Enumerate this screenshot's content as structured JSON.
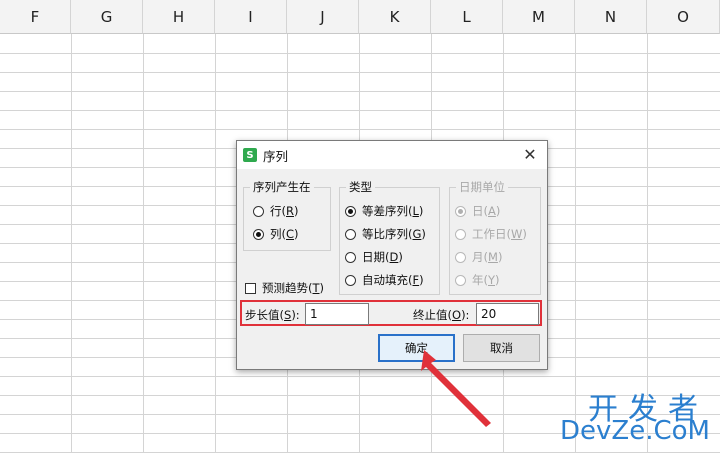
{
  "spreadsheet": {
    "columns": [
      "F",
      "G",
      "H",
      "I",
      "J",
      "K",
      "L",
      "M",
      "N",
      "O"
    ]
  },
  "dialog": {
    "title": "序列",
    "app_icon_glyph": "S",
    "close_glyph": "✕",
    "group_series_in": {
      "legend": "序列产生在",
      "options": [
        {
          "text": "行(",
          "key": "R",
          "suffix": ")",
          "selected": false
        },
        {
          "text": "列(",
          "key": "C",
          "suffix": ")",
          "selected": true
        }
      ]
    },
    "group_type": {
      "legend": "类型",
      "options": [
        {
          "text": "等差序列(",
          "key": "L",
          "suffix": ")",
          "selected": true
        },
        {
          "text": "等比序列(",
          "key": "G",
          "suffix": ")",
          "selected": false
        },
        {
          "text": "日期(",
          "key": "D",
          "suffix": ")",
          "selected": false
        },
        {
          "text": "自动填充(",
          "key": "F",
          "suffix": ")",
          "selected": false
        }
      ]
    },
    "group_date_unit": {
      "legend": "日期单位",
      "options": [
        {
          "text": "日(",
          "key": "A",
          "suffix": ")",
          "selected": true
        },
        {
          "text": "工作日(",
          "key": "W",
          "suffix": ")",
          "selected": false
        },
        {
          "text": "月(",
          "key": "M",
          "suffix": ")",
          "selected": false
        },
        {
          "text": "年(",
          "key": "Y",
          "suffix": ")",
          "selected": false
        }
      ]
    },
    "trend": {
      "text": "预测趋势(",
      "key": "T",
      "suffix": ")",
      "checked": false
    },
    "step": {
      "label": "步长值(",
      "key": "S",
      "suffix": "):",
      "value": "1"
    },
    "stop": {
      "label": "终止值(",
      "key": "O",
      "suffix": "):",
      "value": "20"
    },
    "ok_label": "确定",
    "cancel_label": "取消"
  },
  "watermark": {
    "cn": "开发者",
    "en": "DevZe.CoM"
  },
  "colors": {
    "highlight": "#e0313a",
    "arrow": "#e0313a",
    "watermark": "#2b7fcf"
  }
}
